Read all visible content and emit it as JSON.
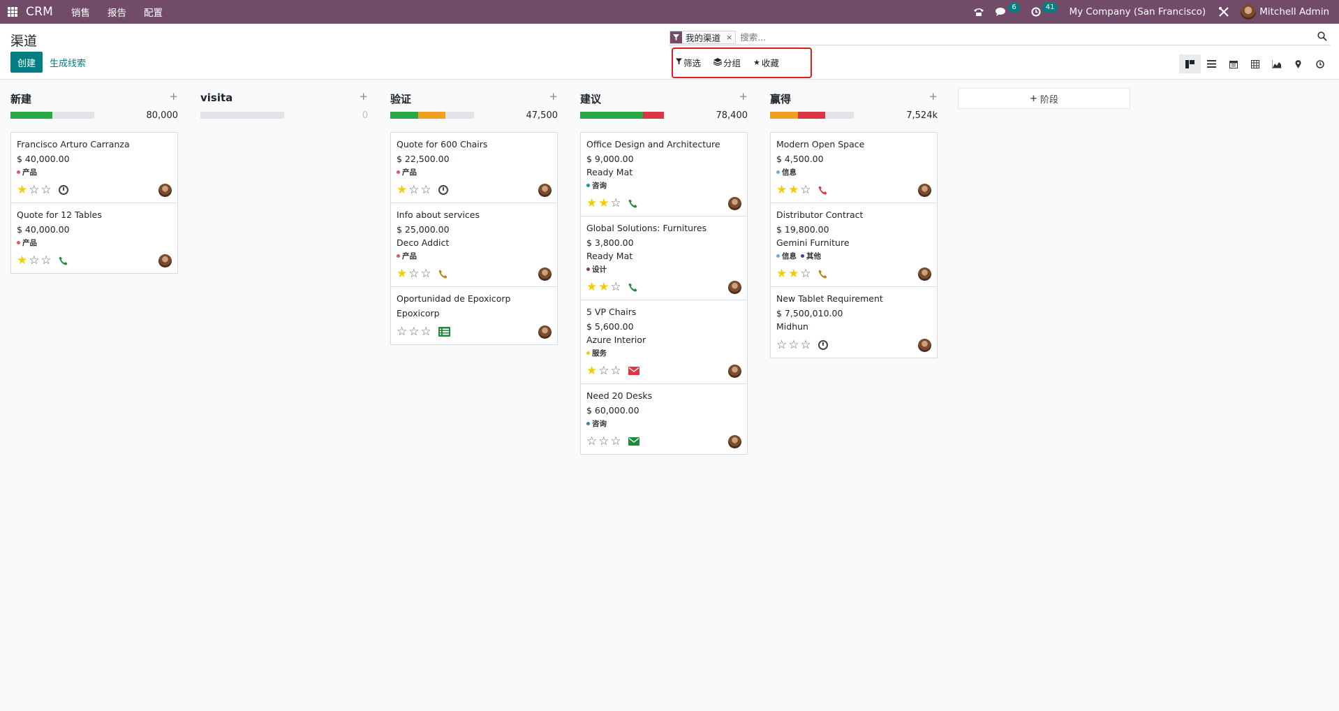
{
  "navbar": {
    "brand": "CRM",
    "menu": [
      "销售",
      "报告",
      "配置"
    ],
    "messages_count": "6",
    "activities_count": "41",
    "company": "My Company (San Francisco)",
    "user": "Mitchell Admin"
  },
  "control": {
    "title": "渠道",
    "create_label": "创建",
    "generate_label": "生成线索",
    "facet": "我的渠道",
    "search_placeholder": "搜索...",
    "filter_label": "筛选",
    "group_label": "分组",
    "favorites_label": "收藏",
    "views": [
      "kanban",
      "list",
      "calendar",
      "pivot",
      "graph",
      "map",
      "activity"
    ]
  },
  "colors": {
    "brand": "#714b67",
    "accent": "#017e84",
    "green": "#28a745",
    "orange": "#f0a020",
    "red": "#dc3545",
    "highlight": "#e31b1b"
  },
  "columns": [
    {
      "title": "新建",
      "total": "80,000",
      "progress": [
        {
          "color": "#28a745",
          "pct": 50
        }
      ],
      "cards": [
        {
          "name": "Francisco Arturo Carranza",
          "amount": "$ 40,000.00",
          "partner": "",
          "tags": [
            {
              "label": "产品",
              "color": "#e4575b"
            }
          ],
          "stars": 1,
          "activity": "clock"
        },
        {
          "name": "Quote for 12 Tables",
          "amount": "$ 40,000.00",
          "partner": "",
          "tags": [
            {
              "label": "产品",
              "color": "#e4575b"
            }
          ],
          "stars": 1,
          "activity": "phone-green"
        }
      ]
    },
    {
      "title": "visita",
      "total": "0",
      "progress": [],
      "cards": []
    },
    {
      "title": "验证",
      "total": "47,500",
      "progress": [
        {
          "color": "#28a745",
          "pct": 33
        },
        {
          "color": "#f0a020",
          "pct": 33
        }
      ],
      "cards": [
        {
          "name": "Quote for 600 Chairs",
          "amount": "$ 22,500.00",
          "partner": "",
          "tags": [
            {
              "label": "产品",
              "color": "#e4575b"
            }
          ],
          "stars": 1,
          "activity": "clock"
        },
        {
          "name": "Info about services",
          "amount": "$ 25,000.00",
          "partner": "Deco Addict",
          "tags": [
            {
              "label": "产品",
              "color": "#e4575b"
            }
          ],
          "stars": 1,
          "activity": "phone-orange"
        },
        {
          "name": "Oportunidad de Epoxicorp",
          "amount": "",
          "partner": "Epoxicorp",
          "tags": [],
          "stars": 0,
          "activity": "task-green"
        }
      ]
    },
    {
      "title": "建议",
      "total": "78,400",
      "progress": [
        {
          "color": "#28a745",
          "pct": 75
        },
        {
          "color": "#dc3545",
          "pct": 25
        }
      ],
      "cards": [
        {
          "name": "Office Design and Architecture",
          "amount": "$ 9,000.00",
          "partner": "Ready Mat",
          "tags": [
            {
              "label": "咨询",
              "color": "#2b8aa3"
            }
          ],
          "stars": 2,
          "activity": "phone-green"
        },
        {
          "name": "Global Solutions: Furnitures",
          "amount": "$ 3,800.00",
          "partner": "Ready Mat",
          "tags": [
            {
              "label": "设计",
              "color": "#7b3f5a"
            }
          ],
          "stars": 2,
          "activity": "phone-green"
        },
        {
          "name": "5 VP Chairs",
          "amount": "$ 5,600.00",
          "partner": "Azure Interior",
          "tags": [
            {
              "label": "服务",
              "color": "#f3cc00"
            }
          ],
          "stars": 1,
          "activity": "mail-red"
        },
        {
          "name": "Need 20 Desks",
          "amount": "$ 60,000.00",
          "partner": "",
          "tags": [
            {
              "label": "咨询",
              "color": "#2b8aa3"
            }
          ],
          "stars": 0,
          "activity": "mail-green"
        }
      ]
    },
    {
      "title": "赢得",
      "total": "7,524k",
      "progress": [
        {
          "color": "#f0a020",
          "pct": 33
        },
        {
          "color": "#dc3545",
          "pct": 33
        }
      ],
      "cards": [
        {
          "name": "Modern Open Space",
          "amount": "$ 4,500.00",
          "partner": "",
          "tags": [
            {
              "label": "信息",
              "color": "#5fb6e0"
            }
          ],
          "stars": 2,
          "activity": "phone-red"
        },
        {
          "name": "Distributor Contract",
          "amount": "$ 19,800.00",
          "partner": "Gemini Furniture",
          "tags": [
            {
              "label": "信息",
              "color": "#5fb6e0"
            },
            {
              "label": "其他",
              "color": "#2e4a8a"
            }
          ],
          "stars": 2,
          "activity": "phone-orange"
        },
        {
          "name": "New Tablet Requirement",
          "amount": "$ 7,500,010.00",
          "partner": "Midhun",
          "tags": [],
          "stars": 0,
          "activity": "clock"
        }
      ]
    }
  ],
  "add_stage_label": "阶段"
}
